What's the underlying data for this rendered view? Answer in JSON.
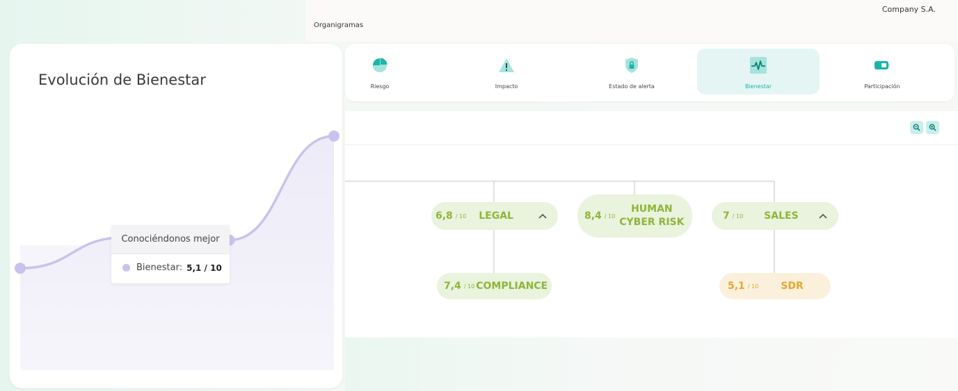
{
  "header": {
    "company_name": "Company S.A.",
    "section_label": "Organigramas"
  },
  "wellbeing_panel": {
    "title": "Evolución de Bienestar",
    "tooltip": {
      "title": "Conociéndonos mejor",
      "series_label": "Bienestar:",
      "value_text": "5,1 / 10"
    },
    "line_color": "#c9c2ec",
    "fill_color": "#f1f0fa"
  },
  "chart_data": {
    "type": "area",
    "title": "Evolución de Bienestar",
    "series": [
      {
        "name": "Bienestar",
        "values": [
          3.5,
          4.6,
          4.5,
          8.2
        ]
      }
    ],
    "ylim": [
      0,
      10
    ],
    "grid": false,
    "legend": "none"
  },
  "tabs": [
    {
      "label": "Riesgo",
      "icon": "pie-chart-icon",
      "active": false
    },
    {
      "label": "Impacto",
      "icon": "warning-triangle-icon",
      "active": false
    },
    {
      "label": "Estado de alerta",
      "icon": "shield-lock-icon",
      "active": false
    },
    {
      "label": "Bienestar",
      "icon": "heartbeat-icon",
      "active": true
    },
    {
      "label": "Participación",
      "icon": "battery-icon",
      "active": false
    }
  ],
  "toolbar": {
    "zoom_out": "zoom-out-icon",
    "zoom_in": "zoom-in-icon"
  },
  "org_nodes": {
    "legal": {
      "score": "6,8",
      "of": "/ 10",
      "name": "LEGAL",
      "expandable": true,
      "color": "#8fb43a"
    },
    "human_cyber_risk": {
      "score": "8,4",
      "of": "/ 10",
      "name_line1": "HUMAN",
      "name_line2": "CYBER RISK",
      "color": "#8fb43a"
    },
    "sales": {
      "score": "7",
      "of": "/ 10",
      "name": "SALES",
      "expandable": true,
      "color": "#8fb43a"
    },
    "compliance": {
      "score": "7,4",
      "of": "/ 10",
      "name": "COMPLIANCE",
      "color": "#8fb43a"
    },
    "sdr": {
      "score": "5,1",
      "of": "/ 10",
      "name": "SDR",
      "color": "#e5a72d"
    }
  },
  "colors": {
    "accent_teal": "#19b5a8",
    "accent_teal_light": "#e4f5f4",
    "good_green": "#8fb43a",
    "warning_orange": "#e5a72d"
  }
}
